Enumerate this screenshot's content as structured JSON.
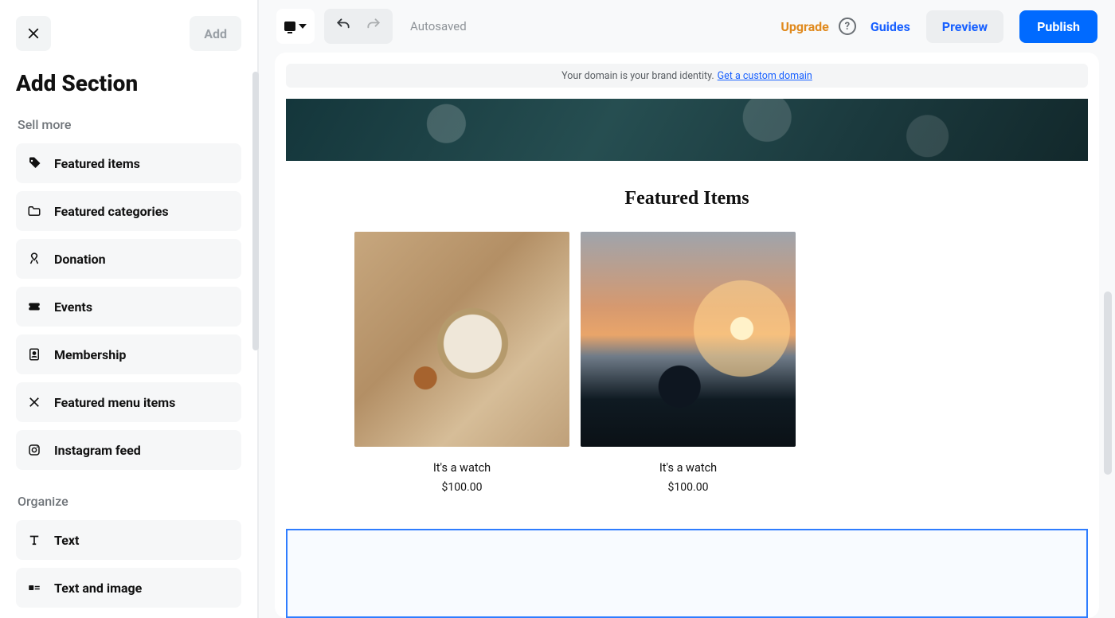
{
  "sidebar": {
    "title": "Add Section",
    "add_label": "Add",
    "groups": [
      {
        "label": "Sell more",
        "items": [
          {
            "icon": "tag-icon",
            "label": "Featured items"
          },
          {
            "icon": "folder-icon",
            "label": "Featured categories"
          },
          {
            "icon": "ribbon-icon",
            "label": "Donation"
          },
          {
            "icon": "ticket-icon",
            "label": "Events"
          },
          {
            "icon": "id-icon",
            "label": "Membership"
          },
          {
            "icon": "utensils-icon",
            "label": "Featured menu items"
          },
          {
            "icon": "instagram-icon",
            "label": "Instagram feed"
          }
        ]
      },
      {
        "label": "Organize",
        "items": [
          {
            "icon": "type-icon",
            "label": "Text"
          },
          {
            "icon": "text-image-icon",
            "label": "Text and image"
          }
        ]
      }
    ]
  },
  "toolbar": {
    "autosaved": "Autosaved",
    "upgrade": "Upgrade",
    "guides": "Guides",
    "preview": "Preview",
    "publish": "Publish"
  },
  "domain_bar": {
    "text": "Your domain is your brand identity.",
    "link": "Get a custom domain"
  },
  "page": {
    "featured_title": "Featured Items",
    "products": [
      {
        "name": "It's a watch",
        "price": "$100.00"
      },
      {
        "name": "It's a watch",
        "price": "$100.00"
      }
    ]
  }
}
